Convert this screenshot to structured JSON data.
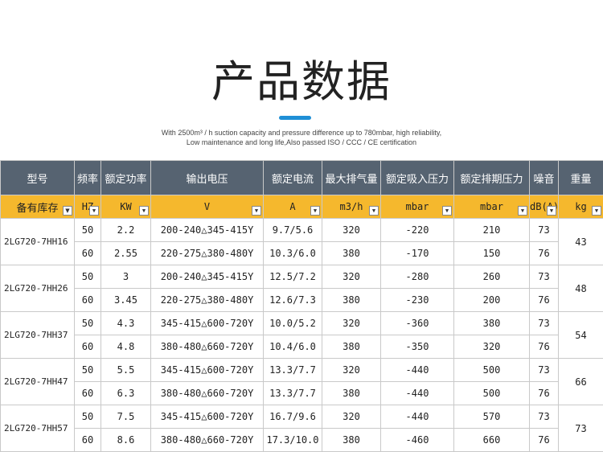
{
  "header": {
    "title": "产品数据",
    "subtitle_line1": "With 2500m³ / h suction capacity and pressure difference up to 780mbar, high reliability,",
    "subtitle_line2": "Low maintenance and long life,Also passed ISO / CCC / CE certification",
    "accent_color": "#1f8fd6"
  },
  "table": {
    "columns": [
      "型号",
      "频率",
      "额定功率",
      "输出电压",
      "额定电流",
      "最大排气量",
      "额定吸入压力",
      "额定排期压力",
      "噪音",
      "重量"
    ],
    "units": [
      "备有库存",
      "HZ",
      "KW",
      "V",
      "A",
      "m3/h",
      "mbar",
      "mbar",
      "dB(A)",
      "kg"
    ],
    "header_color": "#566371",
    "unit_row_color": "#f5b82d",
    "models": [
      {
        "model": "2LG720-7HH16",
        "weight": "43",
        "rows": [
          {
            "hz": "50",
            "kw": "2.2",
            "v": "200-240△345-415Y",
            "a": "9.7/5.6",
            "m3h": "320",
            "suction": "-220",
            "discharge": "210",
            "db": "73"
          },
          {
            "hz": "60",
            "kw": "2.55",
            "v": "220-275△380-480Y",
            "a": "10.3/6.0",
            "m3h": "380",
            "suction": "-170",
            "discharge": "150",
            "db": "76"
          }
        ]
      },
      {
        "model": "2LG720-7HH26",
        "weight": "48",
        "rows": [
          {
            "hz": "50",
            "kw": "3",
            "v": "200-240△345-415Y",
            "a": "12.5/7.2",
            "m3h": "320",
            "suction": "-280",
            "discharge": "260",
            "db": "73"
          },
          {
            "hz": "60",
            "kw": "3.45",
            "v": "220-275△380-480Y",
            "a": "12.6/7.3",
            "m3h": "380",
            "suction": "-230",
            "discharge": "200",
            "db": "76"
          }
        ]
      },
      {
        "model": "2LG720-7HH37",
        "weight": "54",
        "rows": [
          {
            "hz": "50",
            "kw": "4.3",
            "v": "345-415△600-720Y",
            "a": "10.0/5.2",
            "m3h": "320",
            "suction": "-360",
            "discharge": "380",
            "db": "73"
          },
          {
            "hz": "60",
            "kw": "4.8",
            "v": "380-480△660-720Y",
            "a": "10.4/6.0",
            "m3h": "380",
            "suction": "-350",
            "discharge": "320",
            "db": "76"
          }
        ]
      },
      {
        "model": "2LG720-7HH47",
        "weight": "66",
        "rows": [
          {
            "hz": "50",
            "kw": "5.5",
            "v": "345-415△600-720Y",
            "a": "13.3/7.7",
            "m3h": "320",
            "suction": "-440",
            "discharge": "500",
            "db": "73"
          },
          {
            "hz": "60",
            "kw": "6.3",
            "v": "380-480△660-720Y",
            "a": "13.3/7.7",
            "m3h": "380",
            "suction": "-440",
            "discharge": "500",
            "db": "76"
          }
        ]
      },
      {
        "model": "2LG720-7HH57",
        "weight": "73",
        "rows": [
          {
            "hz": "50",
            "kw": "7.5",
            "v": "345-415△600-720Y",
            "a": "16.7/9.6",
            "m3h": "320",
            "suction": "-440",
            "discharge": "570",
            "db": "73"
          },
          {
            "hz": "60",
            "kw": "8.6",
            "v": "380-480△660-720Y",
            "a": "17.3/10.0",
            "m3h": "380",
            "suction": "-460",
            "discharge": "660",
            "db": "76"
          }
        ]
      }
    ]
  }
}
